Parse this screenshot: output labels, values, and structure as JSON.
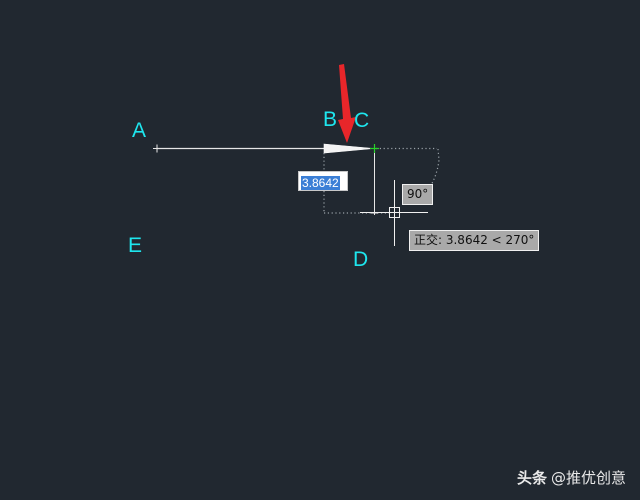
{
  "canvas": {
    "background": "#212830",
    "label_color": "#1ee6ee",
    "point_labels": {
      "a": "A",
      "b": "B",
      "c": "C",
      "d": "D",
      "e": "E"
    }
  },
  "dynamic_input": {
    "value": "3.8642",
    "selected": true
  },
  "tooltips": {
    "angle": "90°",
    "ortho": "正交: 3.8642 < 270°"
  },
  "annotation": {
    "arrow_color": "#e8262a",
    "icon": "red-arrow-icon"
  },
  "watermark": {
    "brand": "头条",
    "handle": "@推优创意"
  }
}
